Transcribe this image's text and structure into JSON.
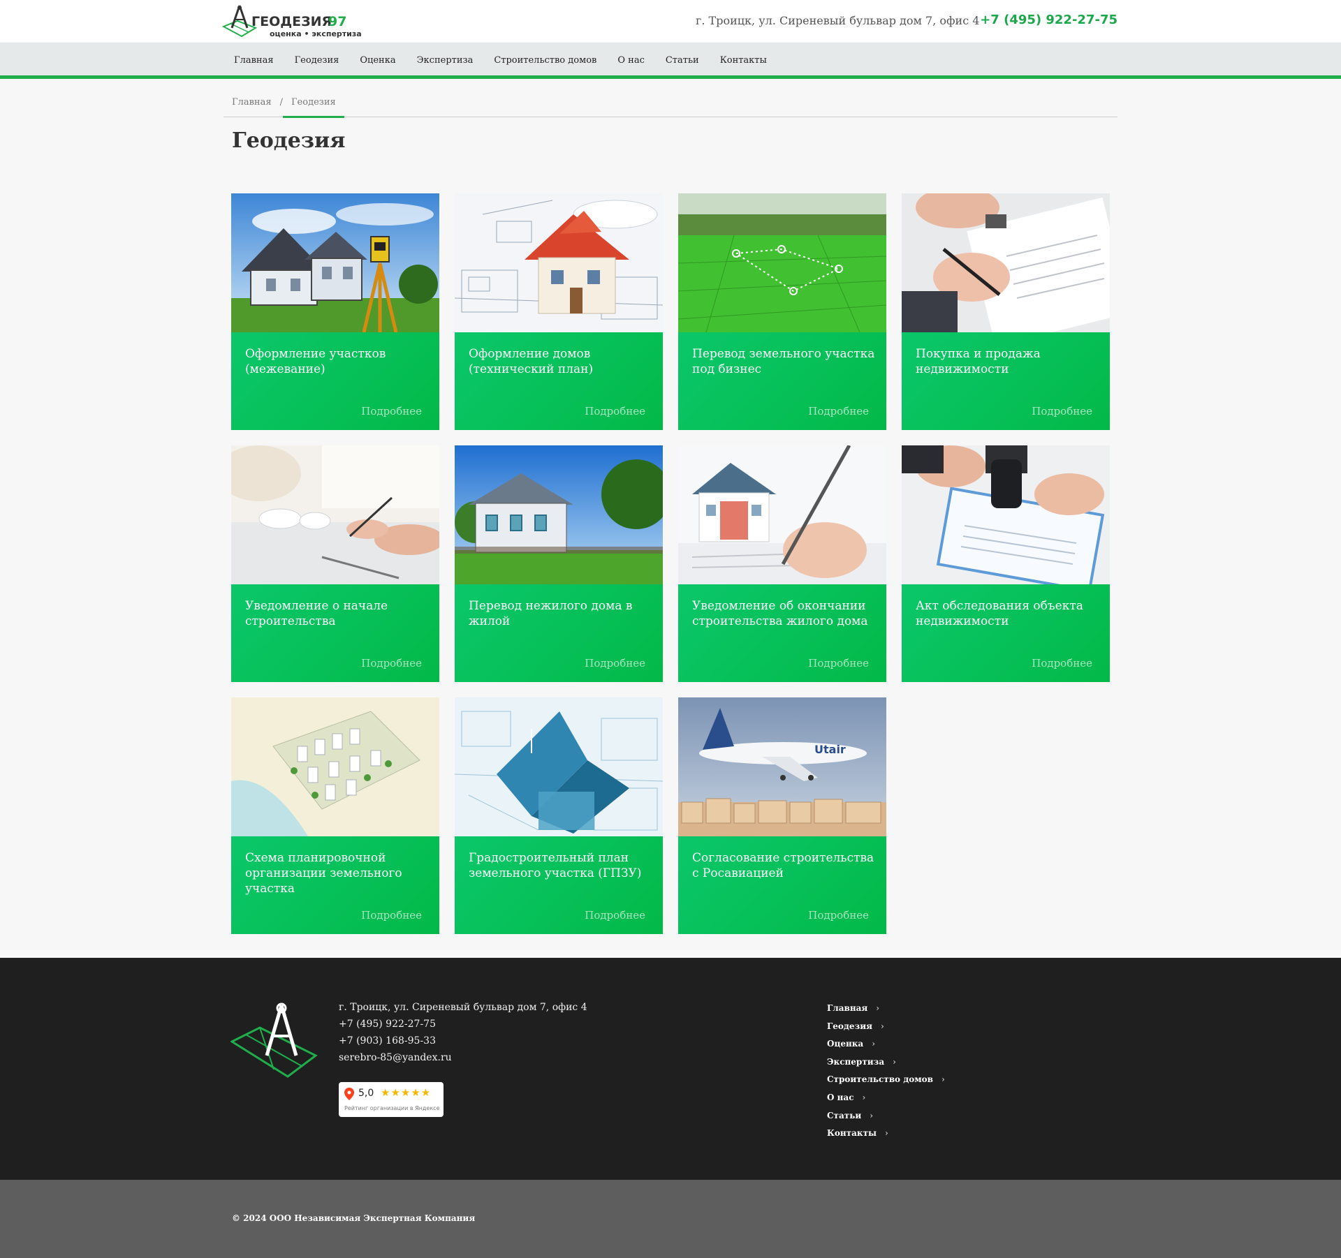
{
  "header": {
    "logo_title": "ГЕОДЕЗИЯ 97",
    "logo_subtitle": "оценка • экспертиза",
    "address": "г. Троицк, ул. Сиреневый бульвар дом 7, офис 4",
    "phone": "+7 (495) 922-27-75"
  },
  "nav": {
    "items": [
      {
        "label": "Главная"
      },
      {
        "label": "Геодезия"
      },
      {
        "label": "Оценка"
      },
      {
        "label": "Экспертиза"
      },
      {
        "label": "Строительство домов"
      },
      {
        "label": "О нас"
      },
      {
        "label": "Статьи"
      },
      {
        "label": "Контакты"
      }
    ]
  },
  "breadcrumb": {
    "home": "Главная",
    "separator": "/",
    "current": "Геодезия"
  },
  "page": {
    "title": "Геодезия"
  },
  "cards": {
    "more_label": "Подробнее",
    "items": [
      {
        "title": "Оформление участков (межевание)",
        "image": "house-theodolite"
      },
      {
        "title": "Оформление домов (технический план)",
        "image": "house-model-blueprints"
      },
      {
        "title": "Перевод земельного участка под бизнес",
        "image": "green-field-markers"
      },
      {
        "title": "Покупка и продажа недвижимости",
        "image": "signing-keys"
      },
      {
        "title": "Уведомление о начале строительства",
        "image": "architect-drawing"
      },
      {
        "title": "Перевод нежилого дома в жилой",
        "image": "village-house"
      },
      {
        "title": "Уведомление об окончании строительства жилого дома",
        "image": "house-pen"
      },
      {
        "title": "Акт обследования объекта недвижимости",
        "image": "stamp-document"
      },
      {
        "title": "Схема планировочной организации земельного участка",
        "image": "district-plan"
      },
      {
        "title": "Градостроительный план земельного участка (ГПЗУ)",
        "image": "blue-house-blueprint"
      },
      {
        "title": "Согласование строительства с Росавиацией",
        "image": "airplane-city"
      }
    ]
  },
  "footer": {
    "address": "г. Троицк, ул. Сиреневый бульвар дом 7, офис 4",
    "phone1": "+7 (495) 922-27-75",
    "phone2": "+7 (903) 168-95-33",
    "email": "serebro-85@yandex.ru",
    "rating": {
      "score": "5,0",
      "stars": "★★★★★",
      "caption": "Рейтинг организации в Яндексе"
    },
    "nav": [
      {
        "label": "Главная"
      },
      {
        "label": "Геодезия"
      },
      {
        "label": "Оценка"
      },
      {
        "label": "Экспертиза"
      },
      {
        "label": "Строительство домов"
      },
      {
        "label": "О нас"
      },
      {
        "label": "Статьи"
      },
      {
        "label": "Контакты"
      }
    ],
    "chevron": "›",
    "copyright": "© 2024 ООО Независимая Экспертная Компания"
  },
  "colors": {
    "accent": "#1fae4b",
    "card_green": "#02b948",
    "footer_dark": "#1f1f1f",
    "copyright_bar": "#5e5e5e",
    "nav_bg": "#e5e9ea"
  }
}
